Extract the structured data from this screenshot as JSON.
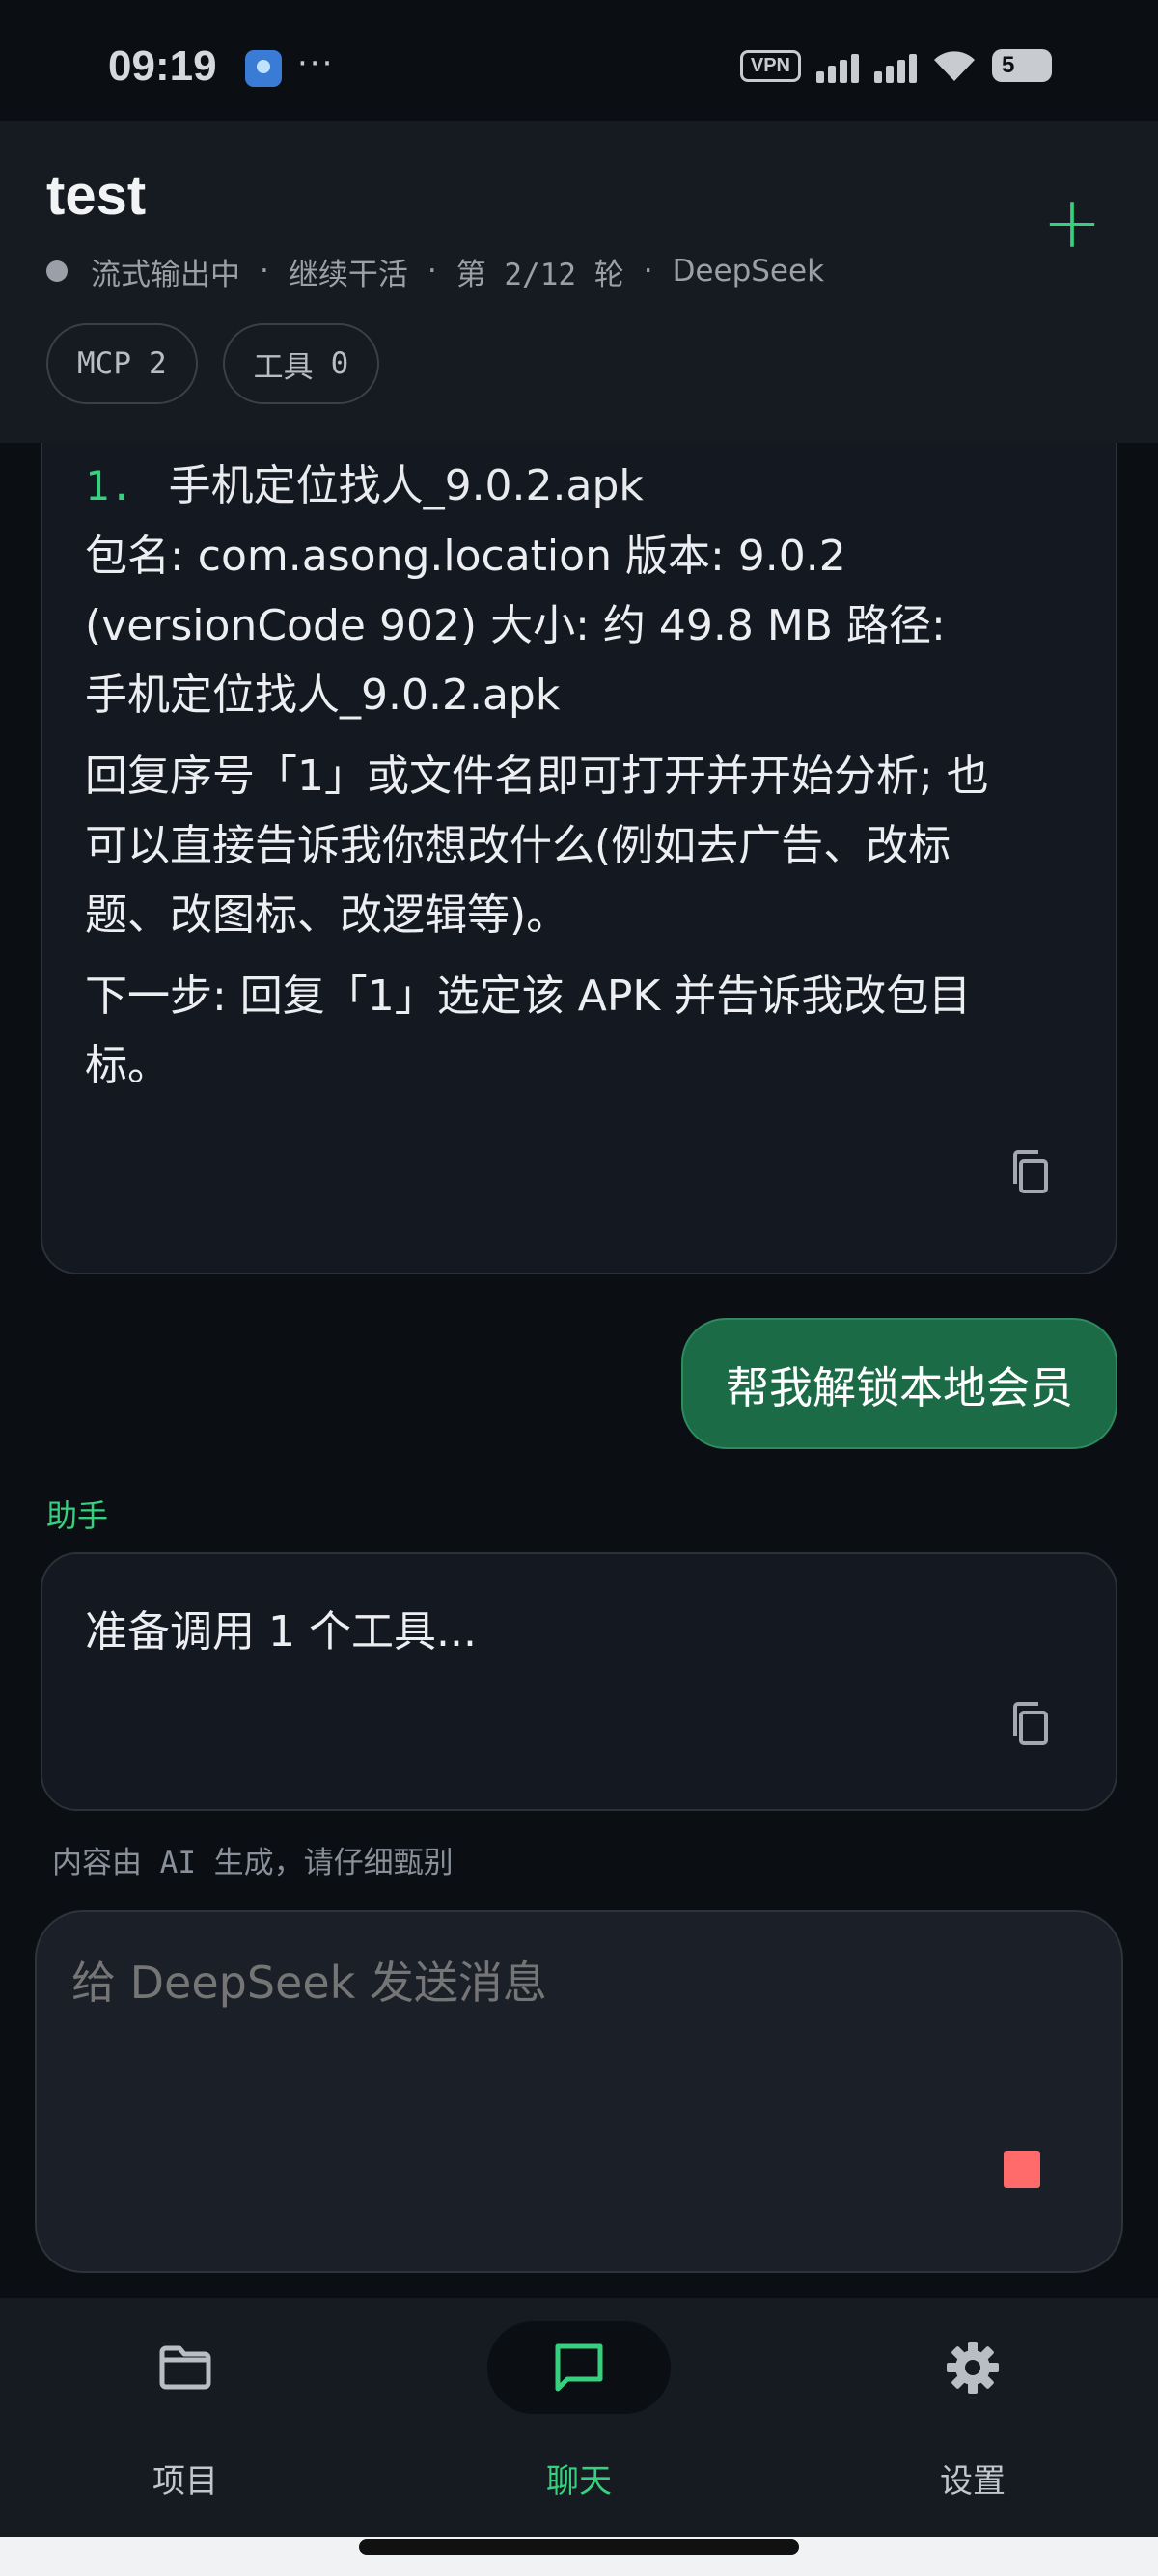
{
  "status_bar": {
    "time": "09:19",
    "more": "···",
    "vpn": "VPN",
    "battery": "5"
  },
  "header": {
    "title": "test",
    "meta": {
      "status": "流式输出中",
      "action": "继续干活",
      "round": "第 2/12 轮",
      "model": "DeepSeek",
      "separator": "·"
    },
    "chips": [
      {
        "label": "MCP",
        "count": "2"
      },
      {
        "label": "工具",
        "count": "0"
      }
    ]
  },
  "chat": {
    "previous_answer": {
      "list_number": "1.",
      "list_item": "手机定位找人_9.0.2.apk",
      "details_line1": "包名: com.asong.location 版本: 9.0.2",
      "details_line2": "(versionCode 902) 大小: 约 49.8 MB 路径:",
      "details_line3": "手机定位找人_9.0.2.apk",
      "reply_line1": "回复序号「1」或文件名即可打开并开始分析; 也",
      "reply_line2": "可以直接告诉我你想改什么(例如去广告、改标",
      "reply_line3": "题、改图标、改逻辑等)。",
      "next_line1": "下一步: 回复「1」选定该 APK 并告诉我改包目",
      "next_line2": "标。"
    },
    "user_message": "帮我解锁本地会员",
    "assistant_label": "助手",
    "assistant_message": "准备调用 1 个工具...",
    "disclaimer": "内容由 AI 生成，请仔细甄别"
  },
  "composer": {
    "placeholder": "给 DeepSeek 发送消息"
  },
  "nav": {
    "items": [
      {
        "label": "项目",
        "icon": "folder-icon"
      },
      {
        "label": "聊天",
        "icon": "chat-icon"
      },
      {
        "label": "设置",
        "icon": "gear-icon"
      }
    ],
    "active_index": 1
  },
  "colors": {
    "accent": "#36d07f",
    "user_bubble": "#1c6b47",
    "stop": "#ff6b6b",
    "background": "#0b0e13"
  }
}
